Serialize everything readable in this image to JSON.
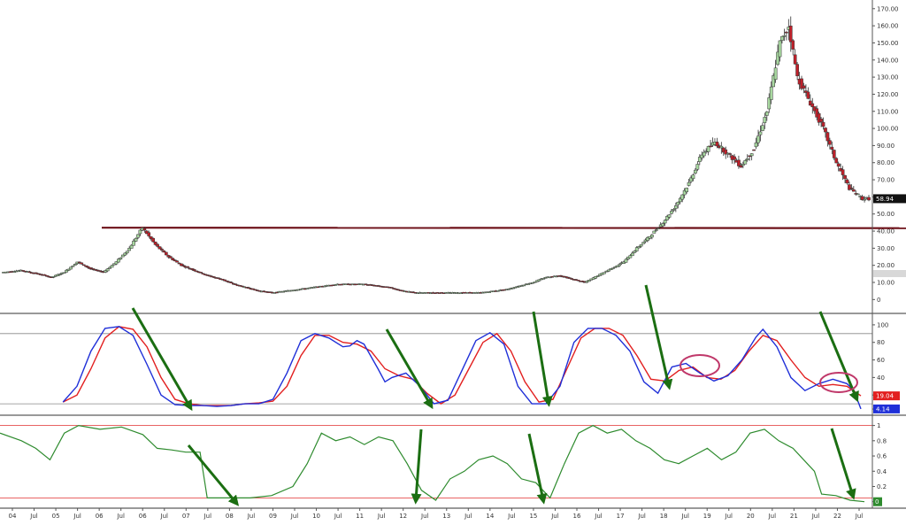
{
  "chart_data": [
    {
      "panel": "price",
      "type": "candlestick",
      "title": "",
      "yticks": [
        0,
        10,
        20,
        30,
        40,
        50,
        60,
        70,
        80,
        90,
        100,
        110,
        120,
        130,
        140,
        150,
        160,
        170
      ],
      "ytick_labels": [
        "0",
        "10.00",
        "20.00",
        "30.00",
        "40.00",
        "50.00",
        "60.00",
        "70.00",
        "80.00",
        "90.00",
        "100.00",
        "110.00",
        "120.00",
        "130.00",
        "140.00",
        "150.00",
        "160.00",
        "170.00"
      ],
      "ylim": [
        -5,
        173
      ],
      "last_price_label": "58.94",
      "last_price": 58.94,
      "resistance_level": 42,
      "grid": false,
      "candle_colors": {
        "up": "#a8d8a0",
        "down": "#c0202a",
        "wick": "#333333"
      },
      "anchors": [
        [
          0,
          16
        ],
        [
          8,
          17
        ],
        [
          16,
          15
        ],
        [
          22,
          13
        ],
        [
          28,
          16
        ],
        [
          34,
          22
        ],
        [
          40,
          18
        ],
        [
          46,
          16
        ],
        [
          52,
          22
        ],
        [
          58,
          30
        ],
        [
          64,
          42
        ],
        [
          70,
          32
        ],
        [
          76,
          25
        ],
        [
          82,
          20
        ],
        [
          88,
          17
        ],
        [
          94,
          14
        ],
        [
          100,
          12
        ],
        [
          106,
          9
        ],
        [
          112,
          7
        ],
        [
          118,
          5
        ],
        [
          124,
          4
        ],
        [
          130,
          5
        ],
        [
          136,
          6
        ],
        [
          142,
          7
        ],
        [
          148,
          8
        ],
        [
          154,
          9
        ],
        [
          160,
          9
        ],
        [
          166,
          9
        ],
        [
          172,
          8
        ],
        [
          178,
          7
        ],
        [
          184,
          5
        ],
        [
          190,
          4
        ],
        [
          196,
          4
        ],
        [
          202,
          4
        ],
        [
          208,
          4
        ],
        [
          214,
          4
        ],
        [
          220,
          4
        ],
        [
          226,
          5
        ],
        [
          232,
          6
        ],
        [
          238,
          8
        ],
        [
          244,
          10
        ],
        [
          250,
          13
        ],
        [
          256,
          14
        ],
        [
          262,
          12
        ],
        [
          268,
          10
        ],
        [
          274,
          14
        ],
        [
          280,
          18
        ],
        [
          286,
          22
        ],
        [
          292,
          30
        ],
        [
          298,
          37
        ],
        [
          304,
          45
        ],
        [
          310,
          55
        ],
        [
          316,
          68
        ],
        [
          322,
          85
        ],
        [
          328,
          92
        ],
        [
          334,
          85
        ],
        [
          340,
          78
        ],
        [
          346,
          88
        ],
        [
          352,
          110
        ],
        [
          358,
          150
        ],
        [
          362,
          160
        ],
        [
          366,
          130
        ],
        [
          372,
          115
        ],
        [
          378,
          100
        ],
        [
          384,
          80
        ],
        [
          390,
          65
        ],
        [
          396,
          58.94
        ]
      ]
    },
    {
      "panel": "stochastic",
      "type": "line",
      "yticks": [
        4,
        20,
        40,
        60,
        80,
        100
      ],
      "ytick_labels": [
        "4",
        "20",
        "40",
        "60",
        "80",
        "100"
      ],
      "ylim": [
        0,
        110
      ],
      "reference_lines": [
        90,
        10
      ],
      "grid": false,
      "series": [
        {
          "color": "#1f2fd8",
          "last_label": "4.14",
          "points": [
            [
              18,
              12
            ],
            [
              22,
              30
            ],
            [
              26,
              70
            ],
            [
              30,
              96
            ],
            [
              34,
              98
            ],
            [
              38,
              88
            ],
            [
              42,
              55
            ],
            [
              46,
              20
            ],
            [
              50,
              9
            ],
            [
              54,
              8
            ],
            [
              58,
              8
            ],
            [
              62,
              7
            ],
            [
              66,
              8
            ],
            [
              70,
              10
            ],
            [
              74,
              10
            ],
            [
              78,
              15
            ],
            [
              82,
              45
            ],
            [
              86,
              82
            ],
            [
              90,
              90
            ],
            [
              94,
              85
            ],
            [
              98,
              75
            ],
            [
              100,
              76
            ],
            [
              102,
              82
            ],
            [
              104,
              78
            ],
            [
              108,
              50
            ],
            [
              110,
              35
            ],
            [
              112,
              40
            ],
            [
              116,
              45
            ],
            [
              120,
              30
            ],
            [
              124,
              10
            ],
            [
              128,
              14
            ],
            [
              132,
              48
            ],
            [
              136,
              82
            ],
            [
              140,
              91
            ],
            [
              144,
              78
            ],
            [
              148,
              30
            ],
            [
              152,
              10
            ],
            [
              156,
              10
            ],
            [
              160,
              30
            ],
            [
              164,
              80
            ],
            [
              168,
              96
            ],
            [
              172,
              96
            ],
            [
              176,
              88
            ],
            [
              180,
              70
            ],
            [
              184,
              35
            ],
            [
              188,
              22
            ],
            [
              192,
              52
            ],
            [
              196,
              56
            ],
            [
              200,
              45
            ],
            [
              204,
              36
            ],
            [
              208,
              42
            ],
            [
              212,
              60
            ],
            [
              216,
              86
            ],
            [
              218,
              95
            ],
            [
              222,
              75
            ],
            [
              226,
              40
            ],
            [
              230,
              25
            ],
            [
              234,
              33
            ],
            [
              238,
              38
            ],
            [
              242,
              33
            ],
            [
              244,
              25
            ],
            [
              246,
              4.14
            ]
          ]
        },
        {
          "color": "#e21f1f",
          "last_label": "19.04",
          "points": [
            [
              18,
              12
            ],
            [
              22,
              20
            ],
            [
              26,
              50
            ],
            [
              30,
              85
            ],
            [
              34,
              98
            ],
            [
              38,
              95
            ],
            [
              42,
              75
            ],
            [
              46,
              40
            ],
            [
              50,
              15
            ],
            [
              54,
              10
            ],
            [
              58,
              8
            ],
            [
              62,
              8
            ],
            [
              66,
              8
            ],
            [
              70,
              10
            ],
            [
              74,
              11
            ],
            [
              78,
              13
            ],
            [
              82,
              30
            ],
            [
              86,
              65
            ],
            [
              90,
              88
            ],
            [
              94,
              88
            ],
            [
              98,
              80
            ],
            [
              102,
              78
            ],
            [
              106,
              70
            ],
            [
              110,
              50
            ],
            [
              114,
              42
            ],
            [
              118,
              38
            ],
            [
              122,
              22
            ],
            [
              126,
              10
            ],
            [
              130,
              20
            ],
            [
              134,
              50
            ],
            [
              138,
              80
            ],
            [
              142,
              90
            ],
            [
              146,
              70
            ],
            [
              150,
              35
            ],
            [
              154,
              12
            ],
            [
              158,
              15
            ],
            [
              162,
              50
            ],
            [
              166,
              85
            ],
            [
              170,
              96
            ],
            [
              174,
              96
            ],
            [
              178,
              88
            ],
            [
              182,
              65
            ],
            [
              186,
              38
            ],
            [
              190,
              36
            ],
            [
              194,
              48
            ],
            [
              198,
              52
            ],
            [
              202,
              40
            ],
            [
              206,
              38
            ],
            [
              210,
              48
            ],
            [
              214,
              70
            ],
            [
              218,
              88
            ],
            [
              222,
              82
            ],
            [
              226,
              60
            ],
            [
              230,
              40
            ],
            [
              234,
              30
            ],
            [
              238,
              32
            ],
            [
              242,
              30
            ],
            [
              246,
              19.04
            ]
          ]
        }
      ]
    },
    {
      "panel": "oscillator",
      "type": "line",
      "yticks": [
        0,
        0.2,
        0.4,
        0.6,
        0.8,
        1
      ],
      "ytick_labels": [
        "0",
        "0.2",
        "0.4",
        "0.6",
        "0.8",
        "1"
      ],
      "ylim": [
        -0.05,
        1.1
      ],
      "reference_lines": [
        1.0,
        0.05
      ],
      "last_value_label": "0",
      "grid": false,
      "series": [
        {
          "color": "#2e8b2e",
          "points": [
            [
              0,
              0.9
            ],
            [
              6,
              0.8
            ],
            [
              10,
              0.7
            ],
            [
              14,
              0.55
            ],
            [
              18,
              0.9
            ],
            [
              22,
              1.0
            ],
            [
              28,
              0.95
            ],
            [
              34,
              0.98
            ],
            [
              40,
              0.88
            ],
            [
              44,
              0.7
            ],
            [
              48,
              0.68
            ],
            [
              52,
              0.65
            ],
            [
              56,
              0.65
            ],
            [
              58,
              0.05
            ],
            [
              64,
              0.05
            ],
            [
              70,
              0.05
            ],
            [
              76,
              0.08
            ],
            [
              82,
              0.2
            ],
            [
              86,
              0.5
            ],
            [
              90,
              0.9
            ],
            [
              94,
              0.8
            ],
            [
              98,
              0.85
            ],
            [
              102,
              0.75
            ],
            [
              106,
              0.85
            ],
            [
              110,
              0.8
            ],
            [
              114,
              0.5
            ],
            [
              118,
              0.15
            ],
            [
              122,
              0.02
            ],
            [
              126,
              0.3
            ],
            [
              130,
              0.4
            ],
            [
              134,
              0.55
            ],
            [
              138,
              0.6
            ],
            [
              142,
              0.5
            ],
            [
              146,
              0.3
            ],
            [
              150,
              0.25
            ],
            [
              154,
              0.05
            ],
            [
              158,
              0.5
            ],
            [
              162,
              0.9
            ],
            [
              166,
              1.0
            ],
            [
              170,
              0.9
            ],
            [
              174,
              0.95
            ],
            [
              178,
              0.8
            ],
            [
              182,
              0.7
            ],
            [
              186,
              0.55
            ],
            [
              190,
              0.5
            ],
            [
              194,
              0.6
            ],
            [
              198,
              0.7
            ],
            [
              202,
              0.55
            ],
            [
              206,
              0.65
            ],
            [
              210,
              0.9
            ],
            [
              214,
              0.95
            ],
            [
              218,
              0.8
            ],
            [
              222,
              0.7
            ],
            [
              226,
              0.5
            ],
            [
              228,
              0.4
            ],
            [
              230,
              0.1
            ],
            [
              234,
              0.08
            ],
            [
              238,
              0.02
            ],
            [
              242,
              0.0
            ]
          ]
        }
      ]
    },
    {
      "panel": "time_axis",
      "type": "axis",
      "x_tick_labels": [
        "04",
        "Jul",
        "05",
        "Jul",
        "06",
        "Jul",
        "06",
        "Jul",
        "07",
        "Jul",
        "08",
        "Jul",
        "09",
        "Jul",
        "10",
        "Jul",
        "11",
        "Jul",
        "12",
        "Jul",
        "13",
        "Jul",
        "14",
        "Jul",
        "15",
        "Jul",
        "16",
        "Jul",
        "17",
        "Jul",
        "18",
        "Jul",
        "19",
        "Jul",
        "20",
        "Jul",
        "21",
        "Jul",
        "22",
        "Jul"
      ]
    }
  ],
  "annotations": {
    "arrow_color": "#1b6e12",
    "highlight_color": "#c0386a"
  }
}
